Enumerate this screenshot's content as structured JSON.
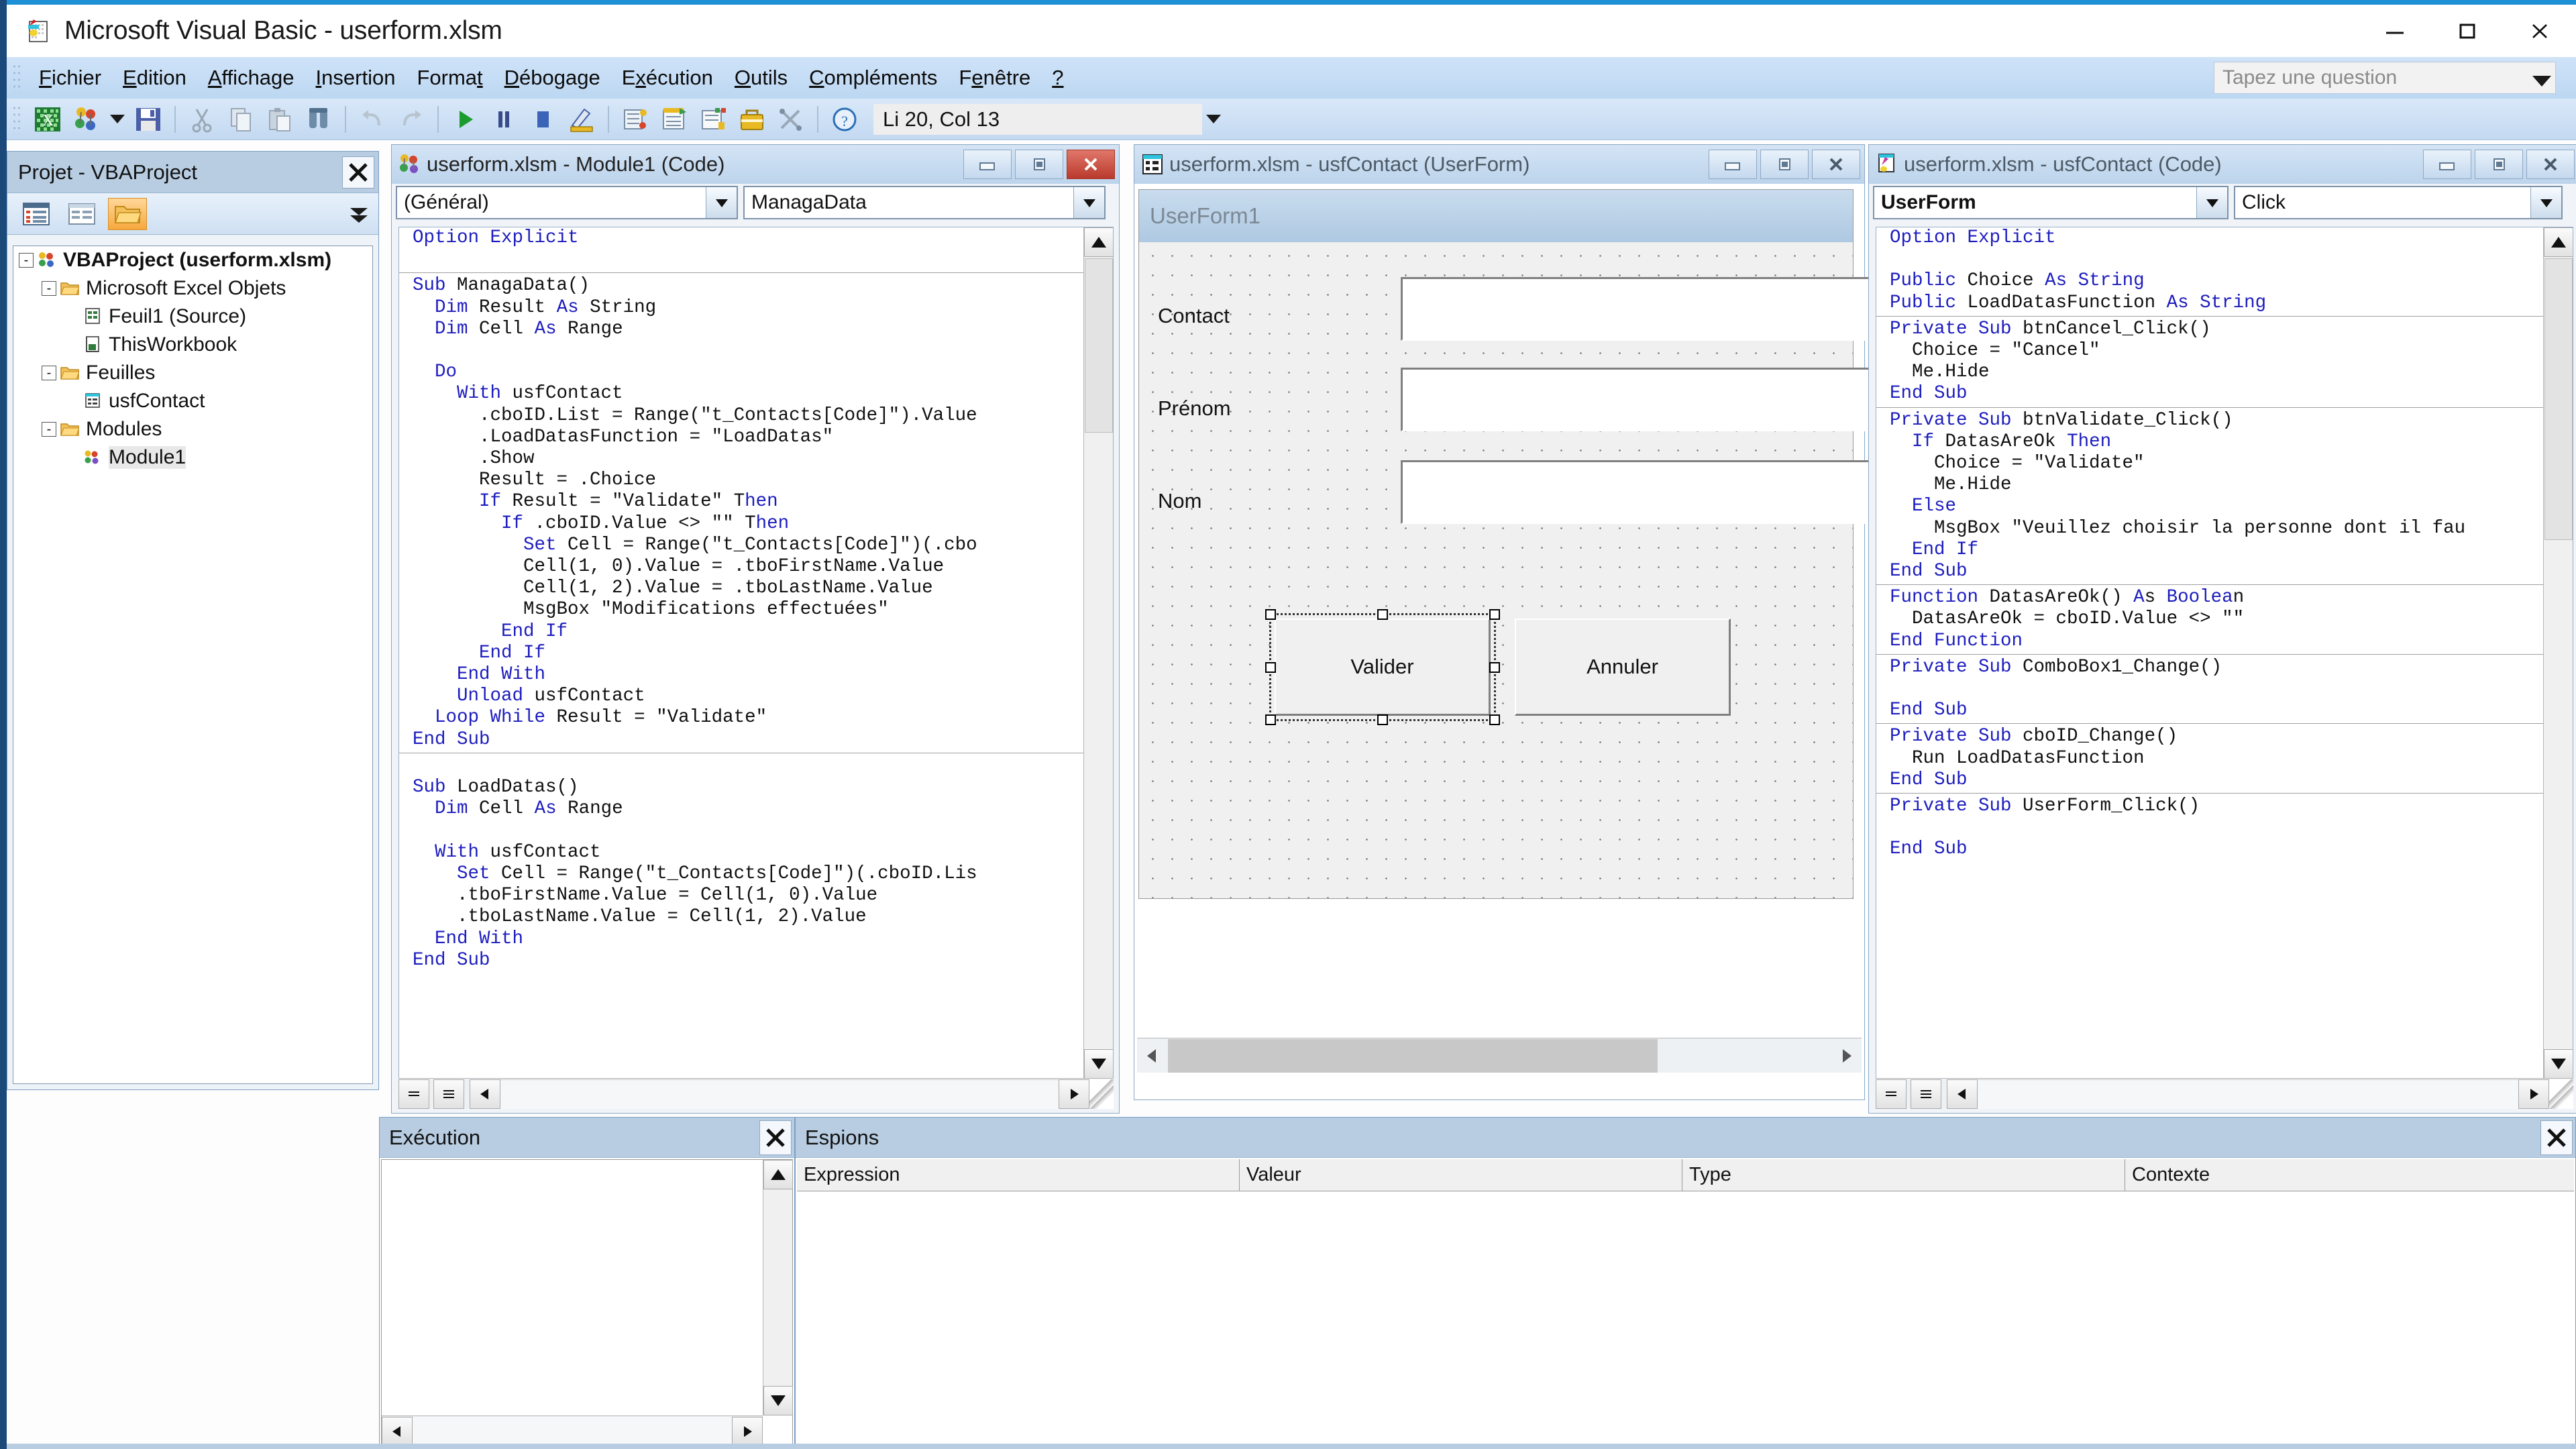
{
  "window": {
    "title": "Microsoft Visual Basic - userform.xlsm",
    "icon": "excel-vba-icon",
    "minimize": "–",
    "maximize": "□",
    "close": "✕"
  },
  "menubar": {
    "items": [
      {
        "pre": "",
        "key": "F",
        "post": "ichier"
      },
      {
        "pre": "",
        "key": "E",
        "post": "dition"
      },
      {
        "pre": "",
        "key": "A",
        "post": "ffichage"
      },
      {
        "pre": "",
        "key": "I",
        "post": "nsertion"
      },
      {
        "pre": "Forma",
        "key": "t",
        "post": ""
      },
      {
        "pre": "",
        "key": "D",
        "post": "ébogage"
      },
      {
        "pre": "E",
        "key": "x",
        "post": "écution"
      },
      {
        "pre": "",
        "key": "O",
        "post": "utils"
      },
      {
        "pre": "",
        "key": "C",
        "post": "ompléments"
      },
      {
        "pre": "F",
        "key": "e",
        "post": "nêtre"
      },
      {
        "pre": "",
        "key": "?",
        "post": ""
      }
    ],
    "ask_placeholder": "Tapez une question"
  },
  "toolbar": {
    "position_status": "Li 20, Col 13",
    "icons": [
      "excel-view-icon",
      "project-objects-icon",
      "dropdown-caret-icon",
      "save-icon",
      "cut-icon",
      "copy-icon",
      "paste-icon",
      "find-icon",
      "undo-icon",
      "redo-icon",
      "run-icon",
      "pause-icon",
      "stop-icon",
      "design-mode-icon",
      "project-explorer-icon",
      "properties-window-icon",
      "object-browser-icon",
      "toolbox-icon",
      "help-icon"
    ]
  },
  "project_explorer": {
    "title": "Projet - VBAProject",
    "close_icon": "close-icon",
    "toolbar_icons": [
      "view-code-icon",
      "view-object-icon",
      "toggle-folders-icon",
      "chevron-down-icon"
    ],
    "tree": [
      {
        "label": "VBAProject (userform.xlsm)",
        "level": 0,
        "icon": "vbaproject-icon",
        "bold": true,
        "expander": "-"
      },
      {
        "label": "Microsoft Excel Objets",
        "level": 1,
        "icon": "folder-icon",
        "bold": false,
        "expander": "-"
      },
      {
        "label": "Feuil1 (Source)",
        "level": 2,
        "icon": "sheet-icon",
        "bold": false,
        "expander": ""
      },
      {
        "label": "ThisWorkbook",
        "level": 2,
        "icon": "workbook-icon",
        "bold": false,
        "expander": ""
      },
      {
        "label": "Feuilles",
        "level": 1,
        "icon": "folder-icon",
        "bold": false,
        "expander": "-"
      },
      {
        "label": "usfContact",
        "level": 2,
        "icon": "userform-icon",
        "bold": false,
        "expander": ""
      },
      {
        "label": "Modules",
        "level": 1,
        "icon": "folder-icon",
        "bold": false,
        "expander": "-"
      },
      {
        "label": "Module1",
        "level": 2,
        "icon": "module-icon",
        "bold": false,
        "expander": "",
        "selected": true
      }
    ]
  },
  "module_window": {
    "title": "userform.xlsm - Module1 (Code)",
    "icon": "module-icon",
    "minimize": "▬",
    "restore": "▣",
    "close": "X",
    "object_dropdown": "(Général)",
    "proc_dropdown": "ManagaData",
    "code_lines": [
      {
        "t": "Option Explicit",
        "k": [
          [
            0,
            15
          ]
        ]
      },
      {
        "t": "",
        "k": []
      },
      {
        "sep": true,
        "t": "",
        "k": []
      },
      {
        "t": "Sub ManagaData()",
        "k": [
          [
            0,
            3
          ]
        ]
      },
      {
        "t": "  Dim Result As String",
        "k": [
          [
            2,
            5
          ],
          [
            13,
            15
          ]
        ]
      },
      {
        "t": "  Dim Cell As Range",
        "k": [
          [
            2,
            5
          ],
          [
            11,
            13
          ]
        ]
      },
      {
        "t": "",
        "k": []
      },
      {
        "t": "  Do",
        "k": [
          [
            2,
            4
          ]
        ]
      },
      {
        "t": "    With usfContact",
        "k": [
          [
            4,
            8
          ]
        ]
      },
      {
        "t": "      .cboID.List = Range(\"t_Contacts[Code]\").Value",
        "k": []
      },
      {
        "t": "      .LoadDatasFunction = \"LoadDatas\"",
        "k": []
      },
      {
        "t": "      .Show",
        "k": []
      },
      {
        "t": "      Result = .Choice",
        "k": []
      },
      {
        "t": "      If Result = \"Validate\" Then",
        "k": [
          [
            6,
            8
          ],
          [
            30,
            34
          ]
        ]
      },
      {
        "t": "        If .cboID.Value <> \"\" Then",
        "k": [
          [
            8,
            10
          ],
          [
            31,
            35
          ]
        ]
      },
      {
        "t": "          Set Cell = Range(\"t_Contacts[Code]\")(.cbo",
        "k": [
          [
            10,
            13
          ]
        ]
      },
      {
        "t": "          Cell(1, 0).Value = .tboFirstName.Value",
        "k": []
      },
      {
        "t": "          Cell(1, 2).Value = .tboLastName.Value",
        "k": []
      },
      {
        "t": "          MsgBox \"Modifications effectuées\"",
        "k": []
      },
      {
        "t": "        End If",
        "k": [
          [
            8,
            14
          ]
        ]
      },
      {
        "t": "      End If",
        "k": [
          [
            6,
            12
          ]
        ]
      },
      {
        "t": "    End With",
        "k": [
          [
            4,
            12
          ]
        ]
      },
      {
        "t": "    Unload usfContact",
        "k": [
          [
            4,
            10
          ]
        ]
      },
      {
        "t": "  Loop While Result = \"Validate\"",
        "k": [
          [
            2,
            12
          ]
        ]
      },
      {
        "t": "End Sub",
        "k": [
          [
            0,
            7
          ]
        ]
      },
      {
        "sep": true,
        "t": "",
        "k": []
      },
      {
        "t": "",
        "k": []
      },
      {
        "t": "Sub LoadDatas()",
        "k": [
          [
            0,
            3
          ]
        ]
      },
      {
        "t": "  Dim Cell As Range",
        "k": [
          [
            2,
            5
          ],
          [
            11,
            13
          ]
        ]
      },
      {
        "t": "",
        "k": []
      },
      {
        "t": "  With usfContact",
        "k": [
          [
            2,
            6
          ]
        ]
      },
      {
        "t": "    Set Cell = Range(\"t_Contacts[Code]\")(.cboID.Lis",
        "k": [
          [
            4,
            7
          ]
        ]
      },
      {
        "t": "    .tboFirstName.Value = Cell(1, 0).Value",
        "k": []
      },
      {
        "t": "    .tboLastName.Value = Cell(1, 2).Value",
        "k": []
      },
      {
        "t": "  End With",
        "k": [
          [
            2,
            10
          ]
        ]
      },
      {
        "t": "End Sub",
        "k": [
          [
            0,
            7
          ]
        ]
      }
    ]
  },
  "userform_window": {
    "title": "userform.xlsm - usfContact (UserForm)",
    "icon": "userform-icon",
    "minimize": "▬",
    "restore": "▣",
    "close": "X",
    "form": {
      "caption": "UserForm1",
      "labels": [
        "Contact",
        "Prénom",
        "Nom"
      ],
      "buttons": [
        "Valider",
        "Annuler"
      ],
      "selected_control": "Valider"
    }
  },
  "usfcontact_code_window": {
    "title": "userform.xlsm - usfContact (Code)",
    "icon": "userform-code-icon",
    "minimize": "▬",
    "restore": "▣",
    "close": "X",
    "object_dropdown": "UserForm",
    "proc_dropdown": "Click",
    "code_lines": [
      {
        "t": "Option Explicit",
        "k": [
          [
            0,
            15
          ]
        ]
      },
      {
        "t": "",
        "k": []
      },
      {
        "t": "Public Choice As String",
        "k": [
          [
            0,
            6
          ],
          [
            14,
            16
          ],
          [
            17,
            23
          ]
        ]
      },
      {
        "t": "Public LoadDatasFunction As String",
        "k": [
          [
            0,
            6
          ],
          [
            25,
            27
          ],
          [
            28,
            34
          ]
        ]
      },
      {
        "sep": true,
        "t": "",
        "k": []
      },
      {
        "t": "Private Sub btnCancel_Click()",
        "k": [
          [
            0,
            11
          ]
        ]
      },
      {
        "t": "  Choice = \"Cancel\"",
        "k": []
      },
      {
        "t": "  Me.Hide",
        "k": []
      },
      {
        "t": "End Sub",
        "k": [
          [
            0,
            7
          ]
        ]
      },
      {
        "sep": true,
        "t": "",
        "k": []
      },
      {
        "t": "Private Sub btnValidate_Click()",
        "k": [
          [
            0,
            11
          ]
        ]
      },
      {
        "t": "  If DatasAreOk Then",
        "k": [
          [
            2,
            4
          ],
          [
            16,
            20
          ]
        ]
      },
      {
        "t": "    Choice = \"Validate\"",
        "k": []
      },
      {
        "t": "    Me.Hide",
        "k": []
      },
      {
        "t": "  Else",
        "k": [
          [
            2,
            6
          ]
        ]
      },
      {
        "t": "    MsgBox \"Veuillez choisir la personne dont il fau",
        "k": []
      },
      {
        "t": "  End If",
        "k": [
          [
            2,
            8
          ]
        ]
      },
      {
        "t": "End Sub",
        "k": [
          [
            0,
            7
          ]
        ]
      },
      {
        "sep": true,
        "t": "",
        "k": []
      },
      {
        "t": "Function DatasAreOk() As Boolean",
        "k": [
          [
            0,
            8
          ],
          [
            21,
            23
          ],
          [
            24,
            31
          ]
        ]
      },
      {
        "t": "  DatasAreOk = cboID.Value <> \"\"",
        "k": []
      },
      {
        "t": "End Function",
        "k": [
          [
            0,
            12
          ]
        ]
      },
      {
        "sep": true,
        "t": "",
        "k": []
      },
      {
        "t": "Private Sub ComboBox1_Change()",
        "k": [
          [
            0,
            11
          ]
        ]
      },
      {
        "t": "",
        "k": []
      },
      {
        "t": "End Sub",
        "k": [
          [
            0,
            7
          ]
        ]
      },
      {
        "sep": true,
        "t": "",
        "k": []
      },
      {
        "t": "Private Sub cboID_Change()",
        "k": [
          [
            0,
            11
          ]
        ]
      },
      {
        "t": "  Run LoadDatasFunction",
        "k": []
      },
      {
        "t": "End Sub",
        "k": [
          [
            0,
            7
          ]
        ]
      },
      {
        "sep": true,
        "t": "",
        "k": []
      },
      {
        "t": "Private Sub UserForm_Click()",
        "k": [
          [
            0,
            11
          ]
        ]
      },
      {
        "t": "",
        "k": []
      },
      {
        "t": "End Sub",
        "k": [
          [
            0,
            7
          ]
        ]
      }
    ]
  },
  "immediate_pane": {
    "title": "Exécution",
    "close_icon": "close-icon",
    "content": ""
  },
  "watch_pane": {
    "title": "Espions",
    "close_icon": "close-icon",
    "columns": [
      "Expression",
      "Valeur",
      "Type",
      "Contexte"
    ],
    "rows": []
  },
  "colors": {
    "accent_blue": "#1e90d6",
    "menu_bg": "#c5dcf5",
    "panel_title": "#b8cde2",
    "keyword": "#1d1dbf",
    "close_red": "#b93a2c",
    "folder_active": "#f7a83c"
  }
}
